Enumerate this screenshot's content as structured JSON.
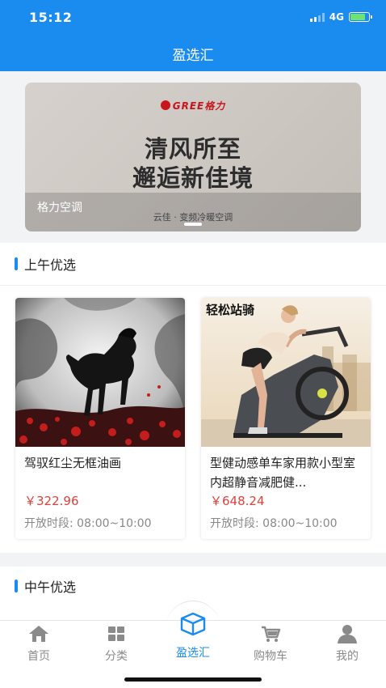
{
  "status": {
    "time": "15:12",
    "network": "4G"
  },
  "header": {
    "title": "盈选汇"
  },
  "banner": {
    "brand": "GREE格力",
    "headline_line1": "清风所至",
    "headline_line2": "邂逅新佳境",
    "caption": "格力空调",
    "subtitle": "云佳 · 变频冷暖空调"
  },
  "sections": [
    {
      "title": "上午优选",
      "products": [
        {
          "name": "驾驭红尘无框油画",
          "price": "￥322.96",
          "hours": "开放时段: 08:00~10:00"
        },
        {
          "name": "型健动感单车家用款小型室内超静音减肥健...",
          "price": "￥648.24",
          "hours": "开放时段: 08:00~10:00",
          "image_text": "轻松站骑"
        }
      ]
    },
    {
      "title": "中午优选"
    }
  ],
  "tabbar": {
    "items": [
      {
        "label": "首页",
        "icon": "home-icon"
      },
      {
        "label": "分类",
        "icon": "grid-icon"
      },
      {
        "label": "盈选汇",
        "icon": "box-icon"
      },
      {
        "label": "购物车",
        "icon": "cart-icon"
      },
      {
        "label": "我的",
        "icon": "user-icon"
      }
    ],
    "active_index": 2
  },
  "colors": {
    "primary": "#1a8cf0",
    "price": "#e0413a"
  }
}
